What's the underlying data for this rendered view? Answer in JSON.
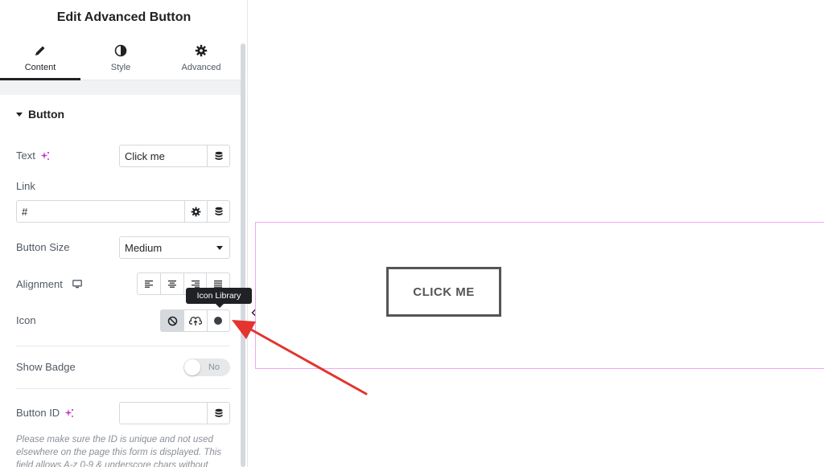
{
  "panel": {
    "title": "Edit Advanced Button",
    "tabs": [
      {
        "label": "Content",
        "icon": "pencil-icon",
        "active": true
      },
      {
        "label": "Style",
        "icon": "half-circle-icon",
        "active": false
      },
      {
        "label": "Advanced",
        "icon": "gear-icon",
        "active": false
      }
    ]
  },
  "section": {
    "title": "Button"
  },
  "fields": {
    "text": {
      "label": "Text",
      "value": "Click me"
    },
    "link": {
      "label": "Link",
      "value": "#"
    },
    "size": {
      "label": "Button Size",
      "value": "Medium"
    },
    "alignment": {
      "label": "Alignment",
      "options": [
        "align-left-icon",
        "align-center-icon",
        "align-right-icon",
        "align-justify-icon"
      ]
    },
    "icon": {
      "label": "Icon",
      "options": [
        "none-icon",
        "upload-icon",
        "circle-icon"
      ],
      "selected": "none-icon",
      "tooltip": "Icon Library"
    },
    "badge": {
      "label": "Show Badge",
      "toggle_text": "No",
      "on": false
    },
    "button_id": {
      "label": "Button ID",
      "value": ""
    }
  },
  "help_text": "Please make sure the ID is unique and not used elsewhere on the page this form is displayed. This field allows A-z 0-9 & underscore chars without",
  "preview": {
    "button_label": "CLICK ME"
  },
  "colors": {
    "accent_pink": "#f0a6f2",
    "arrow_red": "#e3342f",
    "ai_icon": "#c43ec7"
  }
}
